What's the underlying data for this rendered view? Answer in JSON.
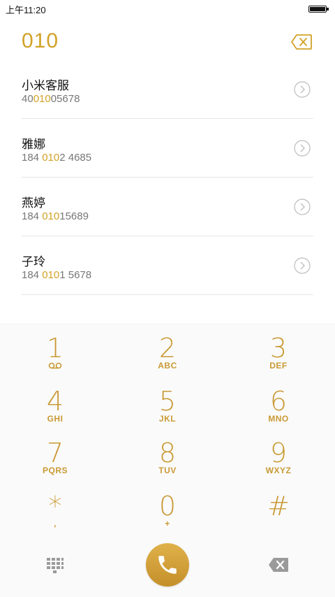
{
  "status_bar": {
    "time": "上午11:20"
  },
  "dialer": {
    "number": "010"
  },
  "contacts": [
    {
      "name": "小米客服",
      "phone_pre": "40",
      "phone_match": "010",
      "phone_post": "05678"
    },
    {
      "name": "雅娜",
      "phone_pre": "184 ",
      "phone_match": "010",
      "phone_post": "2 4685"
    },
    {
      "name": "燕婷",
      "phone_pre": "184 ",
      "phone_match": "010",
      "phone_post": "15689"
    },
    {
      "name": "子玲",
      "phone_pre": "184 ",
      "phone_match": "010",
      "phone_post": "1 5678"
    }
  ],
  "keypad": {
    "k1": {
      "digit": "1",
      "letters": ""
    },
    "k2": {
      "digit": "2",
      "letters": "ABC"
    },
    "k3": {
      "digit": "3",
      "letters": "DEF"
    },
    "k4": {
      "digit": "4",
      "letters": "GHI"
    },
    "k5": {
      "digit": "5",
      "letters": "JKL"
    },
    "k6": {
      "digit": "6",
      "letters": "MNO"
    },
    "k7": {
      "digit": "7",
      "letters": "PQRS"
    },
    "k8": {
      "digit": "8",
      "letters": "TUV"
    },
    "k9": {
      "digit": "9",
      "letters": "WXYZ"
    },
    "kstar": {
      "digit": "*",
      "letters": ","
    },
    "k0": {
      "digit": "0",
      "letters": "+"
    },
    "khash": {
      "digit": "#",
      "letters": ""
    }
  },
  "colors": {
    "accent": "#d2a228",
    "call": "#d4a03a",
    "icon_gray": "#9a9a9a"
  },
  "icons": {
    "voicemail": "voicemail-icon",
    "clear": "backspace-outline-icon",
    "detail": "chevron-right-circle-icon",
    "grid": "dialpad-grid-icon",
    "call": "phone-icon",
    "backspace": "backspace-filled-icon"
  }
}
